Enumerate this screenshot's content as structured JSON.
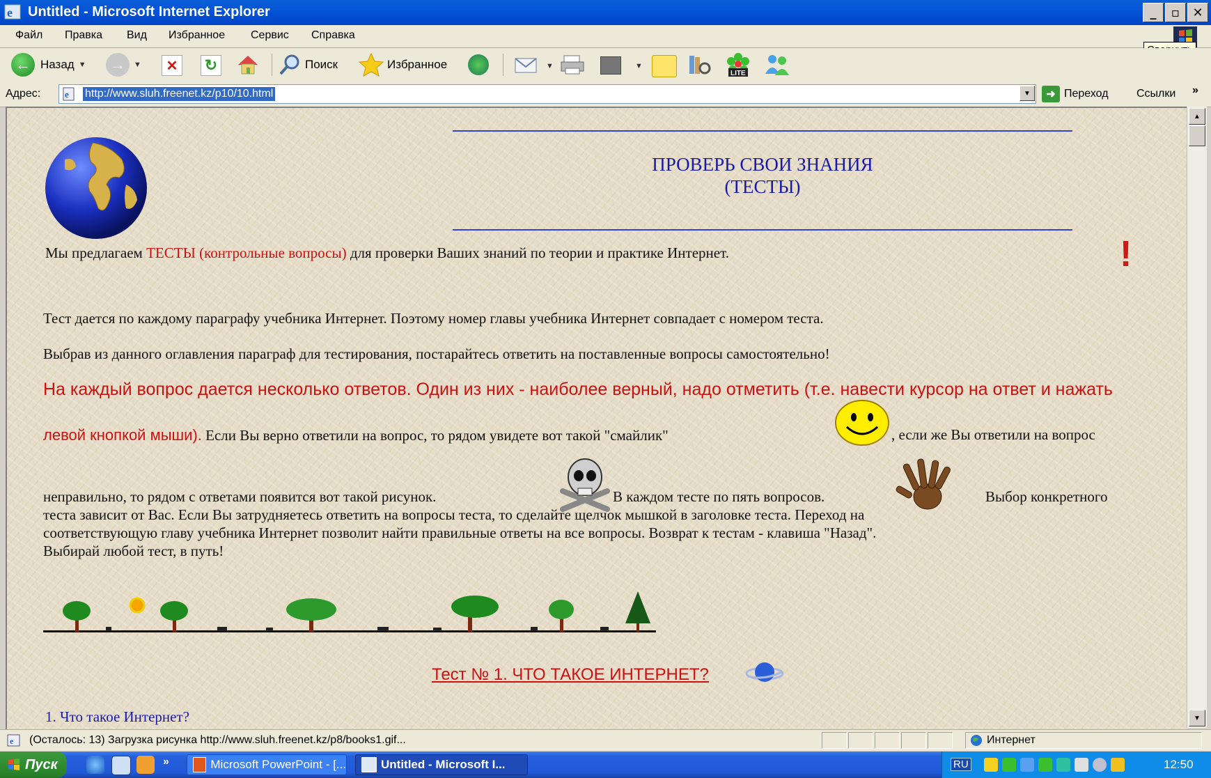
{
  "window": {
    "title": "Untitled - Microsoft Internet Explorer",
    "tooltip": "Свернуть",
    "buttons": {
      "minimize": "_",
      "maximize": "▫",
      "close": "✕"
    }
  },
  "menu": [
    "Файл",
    "Правка",
    "Вид",
    "Избранное",
    "Сервис",
    "Справка"
  ],
  "toolbar": {
    "back_label": "Назад",
    "search_label": "Поиск",
    "favorites_label": "Избранное"
  },
  "address": {
    "label": "Адрес:",
    "url": "http://www.sluh.freenet.kz/p10/10.html",
    "go_label": "Переход",
    "links_label": "Ссылки",
    "chevron": "»"
  },
  "page": {
    "heading_line1": "ПРОВЕРЬ СВОИ ЗНАНИЯ",
    "heading_line2": "(ТЕСТЫ)",
    "p1_start": "Мы предлагаем ",
    "p1_red": "ТЕСТЫ (контрольные вопросы)",
    "p1_end": " для проверки Ваших знаний по теории и практике Интернет.",
    "exclamation": "!",
    "p2": "Тест дается по каждому параграфу учебника Интернет. Поэтому номер главы учебника Интернет совпадает с номером теста.",
    "p3": "Выбрав из данного оглавления параграф для тестирования, постарайтесь ответить на поставленные вопросы самостоятельно!",
    "p4_red": "На каждый вопрос дается несколько ответов. Один из них - наиболее верный, надо отметить (т.е. навести курсор на ответ и нажать",
    "p5_red": "левой кнопкой мыши).",
    "p5_mid": " Если Вы верно ответили на вопрос, то рядом увидете вот такой \"смайлик\" ",
    "p5_end": ", если же Вы ответили на вопрос",
    "p6_start": "неправильно, то рядом с ответами появится вот такой рисунок.",
    "p6_mid": "В каждом тесте по пять вопросов.",
    "p6_end": "Выбор конкретного",
    "p7": "теста зависит от Вас. Если Вы затрудняетесь ответить на вопросы теста, то сделайте щелчок мышкой в заголовке теста. Переход на",
    "p8": "соответствующую главу учебника Интернет позволит найти правильные ответы на все вопросы. Возврат к тестам - клавиша \"Назад\".",
    "p9": "Выбирай любой тест, в путь!",
    "test_link": "Тест № 1. ЧТО ТАКОЕ ИНТЕРНЕТ?",
    "question1": "1. Что такое Интернет?"
  },
  "status": {
    "text": "(Осталось: 13) Загрузка рисунка http://www.sluh.freenet.kz/p8/books1.gif...",
    "zone": "Интернет"
  },
  "taskbar": {
    "start_label": "Пуск",
    "chevron": "»",
    "tasks": [
      {
        "label": "Microsoft PowerPoint - [..."
      },
      {
        "label": "Untitled - Microsoft I..."
      }
    ],
    "lang": "RU",
    "clock": "12:50"
  },
  "colors": {
    "title_blue": "#0453d6",
    "heading_blue": "#1a1aa8",
    "text_red": "#cc1111",
    "page_bg": "#e6ddc9"
  }
}
